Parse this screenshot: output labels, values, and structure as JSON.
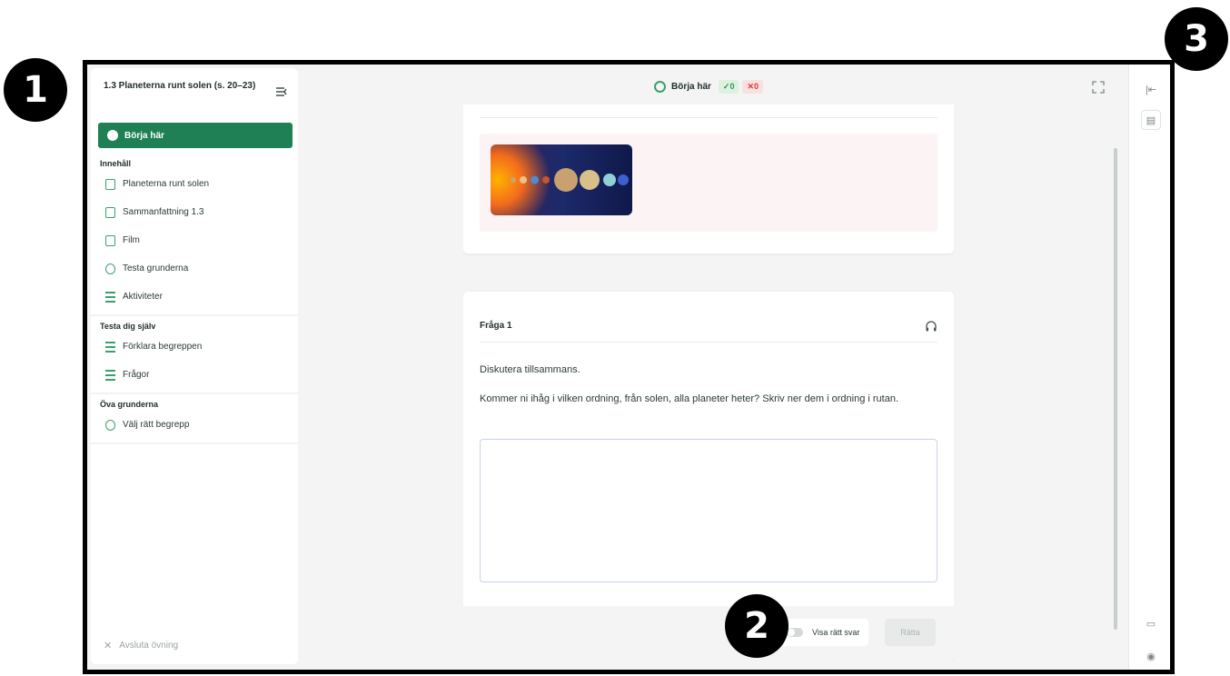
{
  "callouts": [
    "1",
    "2",
    "3"
  ],
  "sidebar": {
    "title": "1.3 Planeterna runt solen (s. 20–23)",
    "active_item": "Börja här",
    "sections": [
      {
        "title": "Innehåll",
        "items": [
          {
            "label": "Planeterna runt solen",
            "icon": "document-icon"
          },
          {
            "label": "Sammanfattning 1.3",
            "icon": "document-icon"
          },
          {
            "label": "Film",
            "icon": "document-icon"
          },
          {
            "label": "Testa grunderna",
            "icon": "quiz-icon"
          },
          {
            "label": "Aktiviteter",
            "icon": "list-icon"
          }
        ]
      },
      {
        "title": "Testa dig själv",
        "items": [
          {
            "label": "Förklara begreppen",
            "icon": "list-icon"
          },
          {
            "label": "Frågor",
            "icon": "list-icon"
          }
        ]
      },
      {
        "title": "Öva grunderna",
        "items": [
          {
            "label": "Välj rätt begrepp",
            "icon": "quiz-icon"
          }
        ]
      }
    ],
    "exit_label": "Avsluta övning"
  },
  "topbar": {
    "title": "Börja här",
    "correct_count": "✓0",
    "wrong_count": "✕0"
  },
  "question": {
    "title": "Fråga 1",
    "instruction": "Diskutera tillsammans.",
    "text": "Kommer ni ihåg i vilken ordning, från solen, alla planeter heter? Skriv ner dem i ordning i rutan.",
    "answer_value": "",
    "show_answer_label": "Visa rätt svar",
    "check_label": "Rätta"
  },
  "colors": {
    "accent": "#1f7f55",
    "correct": "#2f9a52",
    "wrong": "#d33b3b"
  }
}
